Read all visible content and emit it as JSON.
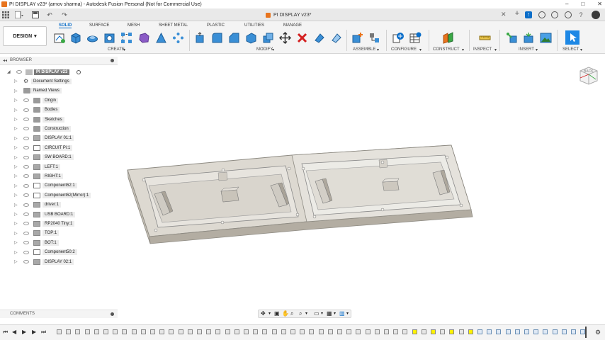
{
  "window": {
    "title": "PI DISPLAY v23* (arnov sharma) - Autodesk Fusion Personal (Not for Commercial Use)",
    "controls": [
      "–",
      "□",
      "✕"
    ]
  },
  "tabbar": {
    "document_tab": "PI DISPLAY v23*",
    "close": "✕",
    "add": "+"
  },
  "toolbar": {
    "workspace": "DESIGN",
    "tabs": [
      "SOLID",
      "SURFACE",
      "MESH",
      "SHEET METAL",
      "PLASTIC",
      "UTILITIES",
      "MANAGE"
    ],
    "active_tab": "SOLID",
    "groups": [
      "CREATE",
      "MODIFY",
      "ASSEMBLE",
      "CONFIGURE",
      "CONSTRUCT",
      "INSPECT",
      "INSERT",
      "SELECT"
    ]
  },
  "browser": {
    "header": "BROWSER",
    "root": "PI DISPLAY v23",
    "items": [
      {
        "label": "Document Settings",
        "icon": "gear-icon"
      },
      {
        "label": "Named Views",
        "icon": "folder-icon"
      },
      {
        "label": "Origin",
        "icon": "folder-icon"
      },
      {
        "label": "Bodies",
        "icon": "folder-icon"
      },
      {
        "label": "Sketches",
        "icon": "folder-icon"
      },
      {
        "label": "Construction",
        "icon": "folder-icon"
      },
      {
        "label": "DISPLAY 01:1",
        "icon": "component-icon"
      },
      {
        "label": "CIRCUIT Pi:1",
        "icon": "linked-component-icon"
      },
      {
        "label": "SW BOARD:1",
        "icon": "component-icon"
      },
      {
        "label": "LEFT:1",
        "icon": "component-icon"
      },
      {
        "label": "RIGHT:1",
        "icon": "component-icon"
      },
      {
        "label": "Component62:1",
        "icon": "linked-component-icon"
      },
      {
        "label": "Component62(Mirror):1",
        "icon": "linked-component-icon"
      },
      {
        "label": "driver:1",
        "icon": "component-icon"
      },
      {
        "label": "USB BOARD:1",
        "icon": "component-icon"
      },
      {
        "label": "RP2040 Tiny:1",
        "icon": "component-icon"
      },
      {
        "label": "TOP:1",
        "icon": "component-icon"
      },
      {
        "label": "BOT:1",
        "icon": "component-icon"
      },
      {
        "label": "Component50:2",
        "icon": "linked-component-icon"
      },
      {
        "label": "DISPLAY 02:1",
        "icon": "component-icon"
      }
    ]
  },
  "comments": {
    "header": "COMMENTS"
  },
  "viewcube": {
    "label": "BACK"
  },
  "colors": {
    "accent": "#0b6ec9",
    "brand": "#e8741e"
  }
}
